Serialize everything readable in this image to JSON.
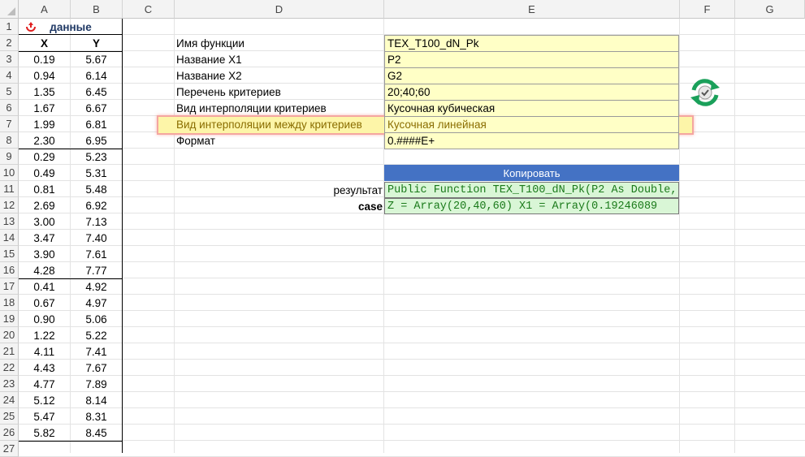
{
  "columns": [
    "A",
    "B",
    "C",
    "D",
    "E",
    "F",
    "G"
  ],
  "rows": [
    "1",
    "2",
    "3",
    "4",
    "5",
    "6",
    "7",
    "8",
    "9",
    "10",
    "11",
    "12",
    "13",
    "14",
    "15",
    "16",
    "17",
    "18",
    "19",
    "20",
    "21",
    "22",
    "23",
    "24",
    "25",
    "26",
    "27"
  ],
  "table": {
    "title": "данные",
    "header_x": "X",
    "header_y": "Y",
    "x": [
      "0.19",
      "0.94",
      "1.35",
      "1.67",
      "1.99",
      "2.30",
      "0.29",
      "0.49",
      "0.81",
      "2.69",
      "3.00",
      "3.47",
      "3.90",
      "4.28",
      "0.41",
      "0.67",
      "0.90",
      "1.22",
      "4.11",
      "4.43",
      "4.77",
      "5.12",
      "5.47",
      "5.82"
    ],
    "y": [
      "5.67",
      "6.14",
      "6.45",
      "6.67",
      "6.81",
      "6.95",
      "5.23",
      "5.31",
      "5.48",
      "6.92",
      "7.13",
      "7.40",
      "7.61",
      "7.77",
      "4.92",
      "4.97",
      "5.06",
      "5.22",
      "7.41",
      "7.67",
      "7.89",
      "8.14",
      "8.31",
      "8.45"
    ]
  },
  "params": {
    "labels": [
      "Имя функции",
      "Название X1",
      "Название X2",
      "Перечень критериев",
      "Вид интерполяции критериев",
      "Вид интерполяции между критериев",
      "Формат"
    ],
    "values": [
      "TEX_T100_dN_Pk",
      "P2",
      "G2",
      "20;40;60",
      "Кусочная кубическая",
      "Кусочная линейная",
      "0.####E+"
    ]
  },
  "copy_button": "Копировать",
  "result_label": "результат",
  "case_label": "case",
  "code_line1": "Public Function TEX_T100_dN_Pk(P2 As Double,",
  "code_line2": "   Z = Array(20,40,60)  X1 = Array(0.19246089",
  "colors": {
    "highlight": "#f4a6a0",
    "button": "#4472c4",
    "code_bg": "#d9f6d6",
    "input_bg": "#ffffc6",
    "icon": "#1aa05a"
  },
  "icons": {
    "recycle": "recycle-icon",
    "refresh": "refresh-icon"
  }
}
